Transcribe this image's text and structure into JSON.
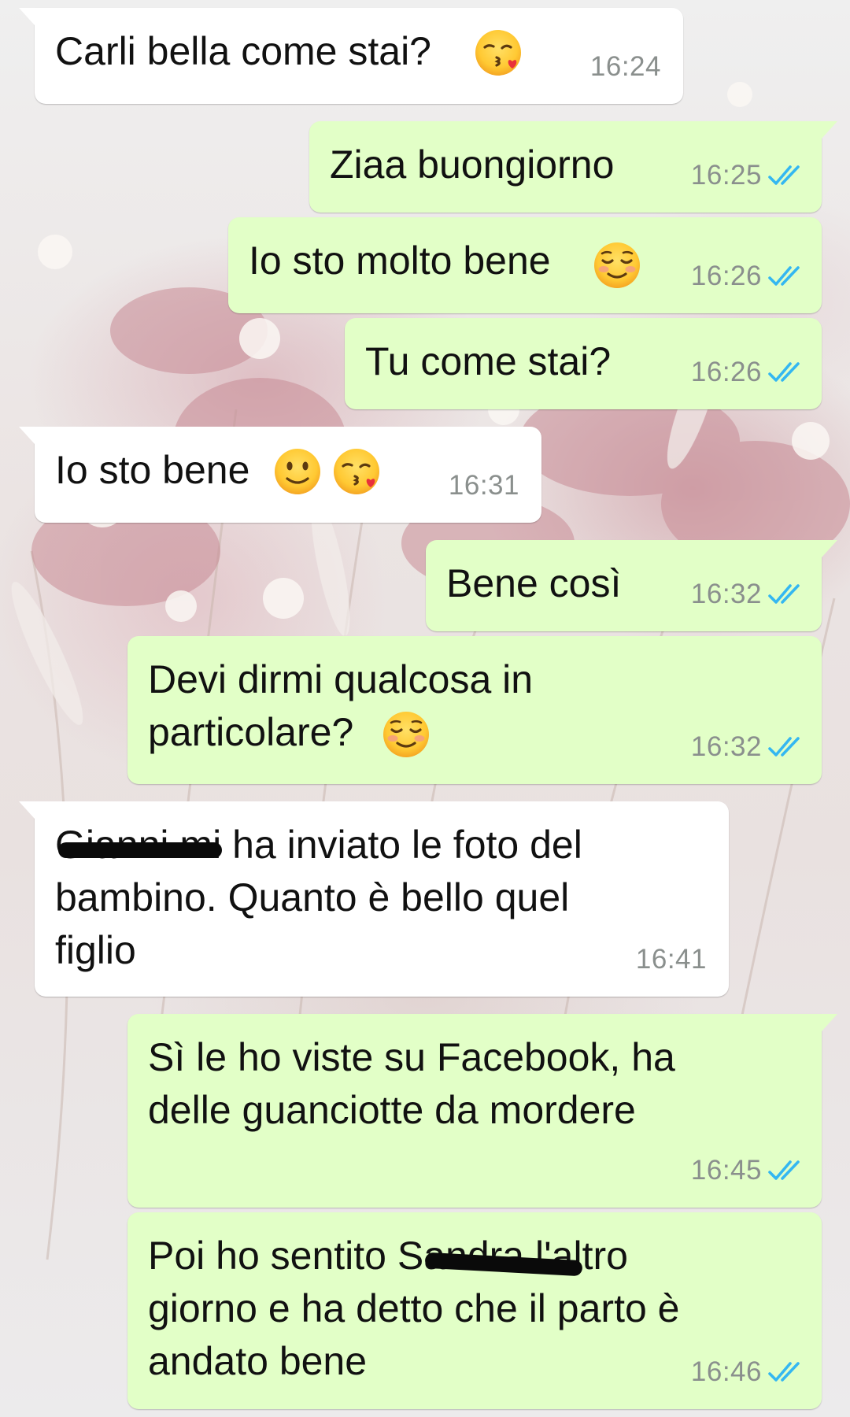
{
  "colors": {
    "incoming_bubble": "#ffffff",
    "outgoing_bubble": "#e2ffc7",
    "timestamp": "#8a8f8d",
    "read_ticks": "#34b7f1"
  },
  "messages": [
    {
      "direction": "incoming",
      "text": "Carli bella come stai?",
      "emoji": "kissing-heart",
      "time": "16:24"
    },
    {
      "direction": "outgoing",
      "text": "Ziaa buongiorno",
      "time": "16:25",
      "status": "read"
    },
    {
      "direction": "outgoing",
      "text": "Io sto molto bene",
      "emoji": "smiling-blush",
      "time": "16:26",
      "status": "read"
    },
    {
      "direction": "outgoing",
      "text": "Tu come stai?",
      "time": "16:26",
      "status": "read"
    },
    {
      "direction": "incoming",
      "text": "Io sto bene",
      "emoji": "slight-smile kissing-heart",
      "time": "16:31"
    },
    {
      "direction": "outgoing",
      "text": "Bene così",
      "time": "16:32",
      "status": "read"
    },
    {
      "direction": "outgoing",
      "text": "Devi dirmi qualcosa in\nparticolare?",
      "emoji": "smiling-blush",
      "time": "16:32",
      "status": "read"
    },
    {
      "direction": "incoming",
      "text": "Gianni mi ha inviato le foto del\nbambino. Quanto è bello quel\nfiglio",
      "redacted": "name",
      "time": "16:41"
    },
    {
      "direction": "outgoing",
      "text": "Sì le ho viste su Facebook, ha\ndelle guanciotte da mordere",
      "time": "16:45",
      "status": "read"
    },
    {
      "direction": "outgoing",
      "text": "Poi ho sentito Sandra l'altro\ngiorno e ha detto che il parto è\nandato bene",
      "redacted": "name",
      "time": "16:46",
      "status": "read"
    }
  ]
}
